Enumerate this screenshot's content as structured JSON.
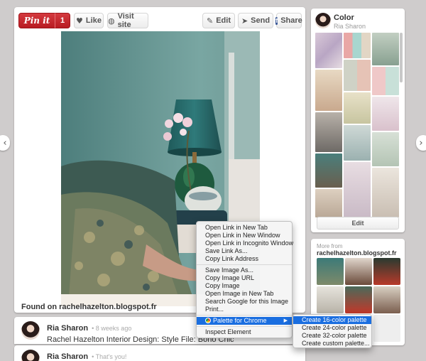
{
  "toolbar": {
    "pinit_label": "Pin it",
    "pin_count": "1",
    "like_label": "Like",
    "visit_label": "Visit site",
    "edit_label": "Edit",
    "send_label": "Send",
    "share_label": "Share"
  },
  "pin": {
    "found_on": "Found on rachelhazelton.blogspot.fr"
  },
  "comments": [
    {
      "name": "Ria Sharon",
      "time": "• 8 weeks ago",
      "text": "Rachel Hazelton Interior Design: Style File: Boho Chic"
    },
    {
      "name": "Ria Sharon",
      "time": "• That's you!"
    }
  ],
  "board": {
    "title": "Color",
    "owner": "Ria Sharon",
    "edit_label": "Edit"
  },
  "more_from": {
    "label": "More from",
    "source": "rachelhazelton.blogspot.fr"
  },
  "context_menu": {
    "items": [
      "Open Link in New Tab",
      "Open Link in New Window",
      "Open Link in Incognito Window",
      "Save Link As...",
      "Copy Link Address",
      "Save Image As...",
      "Copy Image URL",
      "Copy Image",
      "Open Image in New Tab",
      "Search Google for this Image",
      "Print...",
      "Palette for Chrome",
      "Inspect Element"
    ]
  },
  "submenu": {
    "items": [
      "Create 16-color palette",
      "Create 24-color palette",
      "Create 32-color palette",
      "Create custom palette..."
    ]
  },
  "icons": {
    "nav_left": "chevron-left-icon",
    "nav_right": "chevron-right-icon",
    "like": "heart-icon",
    "visit": "globe-icon",
    "edit": "pencil-icon",
    "send": "paper-plane-icon",
    "share": "facebook-icon"
  },
  "colors": {
    "pinit_red": "#c8232c",
    "menu_highlight": "#1a6ee0"
  }
}
